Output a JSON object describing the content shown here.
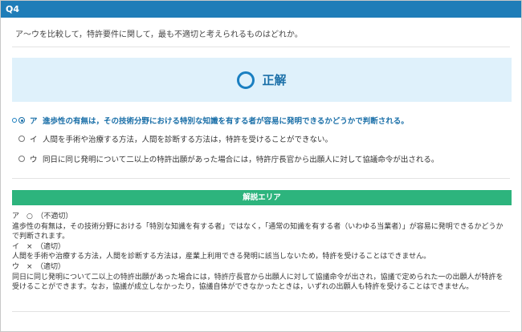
{
  "header": {
    "title": "Q4"
  },
  "question": {
    "text": "ア〜ウを比較して，特許要件に関して，最も不適切と考えられるものはどれか。"
  },
  "result": {
    "icon": "circle-correct-icon",
    "label": "正解"
  },
  "choices": [
    {
      "letter": "ア",
      "text": "進歩性の有無は，その技術分野における特別な知識を有する者が容易に発明できるかどうかで判断される。",
      "selected": true
    },
    {
      "letter": "イ",
      "text": "人間を手術や治療する方法，人間を診断する方法は，特許を受けることができない。",
      "selected": false
    },
    {
      "letter": "ウ",
      "text": "同日に同じ発明について二以上の特許出願があった場合には，特許庁長官から出願人に対して協議命令が出される。",
      "selected": false
    }
  ],
  "explanation": {
    "title": "解説エリア",
    "lines": [
      "ア　○　（不適切）",
      "進歩性の有無は，その技術分野における「特別な知識を有する者」ではなく，「通常の知識を有する者（いわゆる当業者）」が容易に発明できるかどうかで判断されます。",
      "イ　×　（適切）",
      "人間を手術や治療する方法，人間を診断する方法は，産業上利用できる発明に該当しないため，特許を受けることはできません。",
      "ウ　×　（適切）",
      "同日に同じ発明について二以上の特許出願があった場合には，特許庁長官から出願人に対して協議命令が出され，協議で定められた一の出願人が特許を受けることができます。なお，協議が成立しなかったり，協議自体ができなかったときは，いずれの出願人も特許を受けることはできません。"
    ]
  },
  "colors": {
    "header": "#1f7db8",
    "correct_bg": "#dff1fb",
    "correct_text": "#1a6fa8",
    "explanation_header": "#2db47d"
  }
}
